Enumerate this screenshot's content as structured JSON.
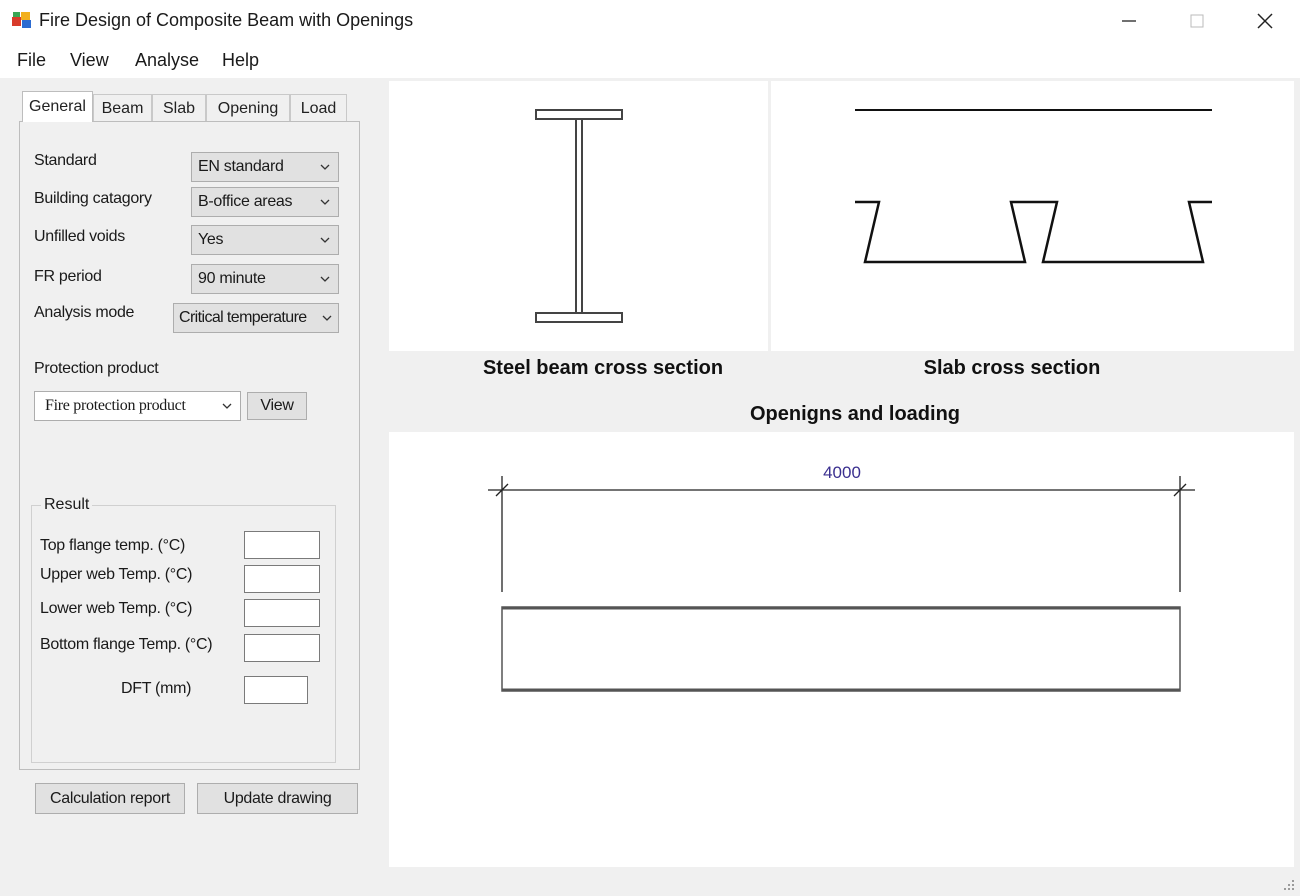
{
  "window": {
    "title": "Fire Design of Composite Beam with Openings"
  },
  "menu": [
    "File",
    "View",
    "Analyse",
    "Help"
  ],
  "tabs": [
    "General",
    "Beam",
    "Slab",
    "Opening",
    "Load"
  ],
  "active_tab": "General",
  "general": {
    "standard_label": "Standard",
    "standard_value": "EN standard",
    "building_category_label": "Building catagory",
    "building_category_value": "B-office areas",
    "unfilled_voids_label": "Unfilled voids",
    "unfilled_voids_value": "Yes",
    "fr_period_label": "FR period",
    "fr_period_value": "90 minute",
    "analysis_mode_label": "Analysis mode",
    "analysis_mode_value": "Critical temperature",
    "protection_product_label": "Protection product",
    "protection_product_value": "Fire protection product",
    "view_button": "View"
  },
  "result": {
    "title": "Result",
    "top_flange_label": "Top flange temp. (°C)",
    "top_flange_value": "",
    "upper_web_label": "Upper web Temp. (°C)",
    "upper_web_value": "",
    "lower_web_label": "Lower web Temp. (°C)",
    "lower_web_value": "",
    "bottom_flange_label": "Bottom flange Temp. (°C)",
    "bottom_flange_value": "",
    "dft_label": "DFT (mm)",
    "dft_value": ""
  },
  "buttons": {
    "calculation_report": "Calculation report",
    "update_drawing": "Update drawing"
  },
  "drawings": {
    "steel_caption": "Steel beam cross section",
    "slab_caption": "Slab cross section",
    "openings_caption": "Openigns and loading",
    "span_dimension": "4000"
  },
  "colors": {
    "dimension_text": "#3a2f8f",
    "window_bg": "#f0f0f0"
  },
  "icons": {
    "app": "app-icon",
    "minimize": "minimize-icon",
    "maximize": "maximize-icon",
    "close": "close-icon",
    "dropdown": "chevron-down-icon",
    "size_grip": "resize-grip-icon"
  }
}
